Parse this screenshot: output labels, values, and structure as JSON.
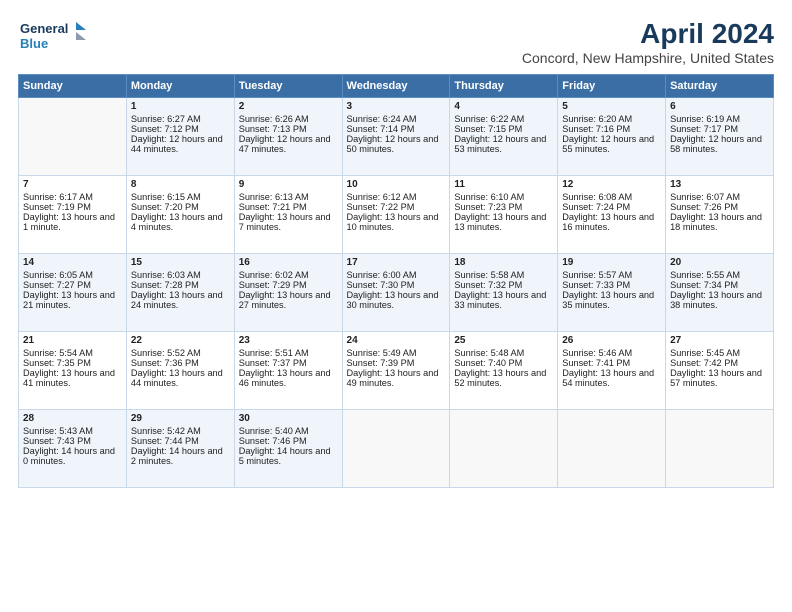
{
  "header": {
    "logo_line1": "General",
    "logo_line2": "Blue",
    "title": "April 2024",
    "subtitle": "Concord, New Hampshire, United States"
  },
  "days": [
    "Sunday",
    "Monday",
    "Tuesday",
    "Wednesday",
    "Thursday",
    "Friday",
    "Saturday"
  ],
  "weeks": [
    [
      {
        "date": "",
        "sunrise": "",
        "sunset": "",
        "daylight": ""
      },
      {
        "date": "1",
        "sunrise": "Sunrise: 6:27 AM",
        "sunset": "Sunset: 7:12 PM",
        "daylight": "Daylight: 12 hours and 44 minutes."
      },
      {
        "date": "2",
        "sunrise": "Sunrise: 6:26 AM",
        "sunset": "Sunset: 7:13 PM",
        "daylight": "Daylight: 12 hours and 47 minutes."
      },
      {
        "date": "3",
        "sunrise": "Sunrise: 6:24 AM",
        "sunset": "Sunset: 7:14 PM",
        "daylight": "Daylight: 12 hours and 50 minutes."
      },
      {
        "date": "4",
        "sunrise": "Sunrise: 6:22 AM",
        "sunset": "Sunset: 7:15 PM",
        "daylight": "Daylight: 12 hours and 53 minutes."
      },
      {
        "date": "5",
        "sunrise": "Sunrise: 6:20 AM",
        "sunset": "Sunset: 7:16 PM",
        "daylight": "Daylight: 12 hours and 55 minutes."
      },
      {
        "date": "6",
        "sunrise": "Sunrise: 6:19 AM",
        "sunset": "Sunset: 7:17 PM",
        "daylight": "Daylight: 12 hours and 58 minutes."
      }
    ],
    [
      {
        "date": "7",
        "sunrise": "Sunrise: 6:17 AM",
        "sunset": "Sunset: 7:19 PM",
        "daylight": "Daylight: 13 hours and 1 minute."
      },
      {
        "date": "8",
        "sunrise": "Sunrise: 6:15 AM",
        "sunset": "Sunset: 7:20 PM",
        "daylight": "Daylight: 13 hours and 4 minutes."
      },
      {
        "date": "9",
        "sunrise": "Sunrise: 6:13 AM",
        "sunset": "Sunset: 7:21 PM",
        "daylight": "Daylight: 13 hours and 7 minutes."
      },
      {
        "date": "10",
        "sunrise": "Sunrise: 6:12 AM",
        "sunset": "Sunset: 7:22 PM",
        "daylight": "Daylight: 13 hours and 10 minutes."
      },
      {
        "date": "11",
        "sunrise": "Sunrise: 6:10 AM",
        "sunset": "Sunset: 7:23 PM",
        "daylight": "Daylight: 13 hours and 13 minutes."
      },
      {
        "date": "12",
        "sunrise": "Sunrise: 6:08 AM",
        "sunset": "Sunset: 7:24 PM",
        "daylight": "Daylight: 13 hours and 16 minutes."
      },
      {
        "date": "13",
        "sunrise": "Sunrise: 6:07 AM",
        "sunset": "Sunset: 7:26 PM",
        "daylight": "Daylight: 13 hours and 18 minutes."
      }
    ],
    [
      {
        "date": "14",
        "sunrise": "Sunrise: 6:05 AM",
        "sunset": "Sunset: 7:27 PM",
        "daylight": "Daylight: 13 hours and 21 minutes."
      },
      {
        "date": "15",
        "sunrise": "Sunrise: 6:03 AM",
        "sunset": "Sunset: 7:28 PM",
        "daylight": "Daylight: 13 hours and 24 minutes."
      },
      {
        "date": "16",
        "sunrise": "Sunrise: 6:02 AM",
        "sunset": "Sunset: 7:29 PM",
        "daylight": "Daylight: 13 hours and 27 minutes."
      },
      {
        "date": "17",
        "sunrise": "Sunrise: 6:00 AM",
        "sunset": "Sunset: 7:30 PM",
        "daylight": "Daylight: 13 hours and 30 minutes."
      },
      {
        "date": "18",
        "sunrise": "Sunrise: 5:58 AM",
        "sunset": "Sunset: 7:32 PM",
        "daylight": "Daylight: 13 hours and 33 minutes."
      },
      {
        "date": "19",
        "sunrise": "Sunrise: 5:57 AM",
        "sunset": "Sunset: 7:33 PM",
        "daylight": "Daylight: 13 hours and 35 minutes."
      },
      {
        "date": "20",
        "sunrise": "Sunrise: 5:55 AM",
        "sunset": "Sunset: 7:34 PM",
        "daylight": "Daylight: 13 hours and 38 minutes."
      }
    ],
    [
      {
        "date": "21",
        "sunrise": "Sunrise: 5:54 AM",
        "sunset": "Sunset: 7:35 PM",
        "daylight": "Daylight: 13 hours and 41 minutes."
      },
      {
        "date": "22",
        "sunrise": "Sunrise: 5:52 AM",
        "sunset": "Sunset: 7:36 PM",
        "daylight": "Daylight: 13 hours and 44 minutes."
      },
      {
        "date": "23",
        "sunrise": "Sunrise: 5:51 AM",
        "sunset": "Sunset: 7:37 PM",
        "daylight": "Daylight: 13 hours and 46 minutes."
      },
      {
        "date": "24",
        "sunrise": "Sunrise: 5:49 AM",
        "sunset": "Sunset: 7:39 PM",
        "daylight": "Daylight: 13 hours and 49 minutes."
      },
      {
        "date": "25",
        "sunrise": "Sunrise: 5:48 AM",
        "sunset": "Sunset: 7:40 PM",
        "daylight": "Daylight: 13 hours and 52 minutes."
      },
      {
        "date": "26",
        "sunrise": "Sunrise: 5:46 AM",
        "sunset": "Sunset: 7:41 PM",
        "daylight": "Daylight: 13 hours and 54 minutes."
      },
      {
        "date": "27",
        "sunrise": "Sunrise: 5:45 AM",
        "sunset": "Sunset: 7:42 PM",
        "daylight": "Daylight: 13 hours and 57 minutes."
      }
    ],
    [
      {
        "date": "28",
        "sunrise": "Sunrise: 5:43 AM",
        "sunset": "Sunset: 7:43 PM",
        "daylight": "Daylight: 14 hours and 0 minutes."
      },
      {
        "date": "29",
        "sunrise": "Sunrise: 5:42 AM",
        "sunset": "Sunset: 7:44 PM",
        "daylight": "Daylight: 14 hours and 2 minutes."
      },
      {
        "date": "30",
        "sunrise": "Sunrise: 5:40 AM",
        "sunset": "Sunset: 7:46 PM",
        "daylight": "Daylight: 14 hours and 5 minutes."
      },
      {
        "date": "",
        "sunrise": "",
        "sunset": "",
        "daylight": ""
      },
      {
        "date": "",
        "sunrise": "",
        "sunset": "",
        "daylight": ""
      },
      {
        "date": "",
        "sunrise": "",
        "sunset": "",
        "daylight": ""
      },
      {
        "date": "",
        "sunrise": "",
        "sunset": "",
        "daylight": ""
      }
    ]
  ]
}
